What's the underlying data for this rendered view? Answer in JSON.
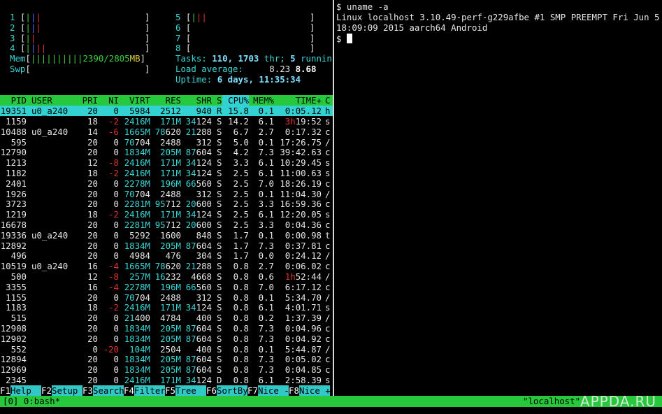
{
  "cpus": [
    {
      "label": "1",
      "bars": [
        "|",
        "|",
        "|"
      ],
      "colors": [
        "gr",
        "bl",
        "rd"
      ]
    },
    {
      "label": "2",
      "bars": [
        "|",
        "|",
        "|"
      ],
      "colors": [
        "gr",
        "bl",
        "rd"
      ]
    },
    {
      "label": "3",
      "bars": [
        "|",
        "|"
      ],
      "colors": [
        "gr",
        "rd"
      ]
    },
    {
      "label": "4",
      "bars": [
        "|",
        "|",
        "|",
        "|"
      ],
      "colors": [
        "gr",
        "bl",
        "rd",
        "rd"
      ]
    },
    {
      "label": "5",
      "bars": [
        "|",
        "|",
        "|"
      ],
      "colors": [
        "gr",
        "rd",
        "rd"
      ]
    },
    {
      "label": "6",
      "bars": [],
      "colors": []
    },
    {
      "label": "7",
      "bars": [],
      "colors": []
    },
    {
      "label": "8",
      "bars": [],
      "colors": []
    }
  ],
  "mem": {
    "label": "Mem",
    "bars": "||||||||||",
    "used": "2390/2805",
    "unit": "MB"
  },
  "swp": {
    "label": "Swp"
  },
  "tasks": {
    "label": "Tasks:",
    "count": "110,",
    "threads": "1703",
    "thr": "thr;",
    "running": "5",
    "running_label": "runnin"
  },
  "load": {
    "label": "Load average:",
    "v1": "8.23",
    "v2": "8.68"
  },
  "uptime": {
    "label": "Uptime:",
    "value": "6 days, 11:35:34"
  },
  "columns": [
    "PID",
    "USER",
    "PRI",
    "NI",
    "VIRT",
    "RES",
    "SHR",
    "S",
    "CPU%",
    "MEM%",
    "TIME+",
    "C"
  ],
  "selected": {
    "pid": "19351",
    "user": "u0_a240",
    "pri": "20",
    "ni": "0",
    "virt": "5984",
    "res": "2512",
    "shr": "940",
    "s": "R",
    "cpu": "15.8",
    "mem": "0.1",
    "time": "0:05.12",
    "c": "h"
  },
  "rows": [
    {
      "pid": "1159",
      "user": "",
      "pri": "18",
      "ni": "-2",
      "virt": "2416M",
      "res": "171M",
      "shr": "34124",
      "s": "S",
      "cpu": "14.2",
      "mem": "6.1",
      "time": "3h19:52",
      "c": "s"
    },
    {
      "pid": "10488",
      "user": "u0_a240",
      "pri": "14",
      "ni": "-6",
      "virt": "1665M",
      "res": "78620",
      "shr": "21288",
      "s": "S",
      "cpu": "6.7",
      "mem": "2.7",
      "time": "0:17.32",
      "c": "c"
    },
    {
      "pid": "595",
      "user": "",
      "pri": "20",
      "ni": "0",
      "virt": "70704",
      "res": "2488",
      "shr": "312",
      "s": "S",
      "cpu": "5.0",
      "mem": "0.1",
      "time": "17:26.75",
      "c": "/"
    },
    {
      "pid": "12790",
      "user": "",
      "pri": "20",
      "ni": "0",
      "virt": "1834M",
      "res": "205M",
      "shr": "87604",
      "s": "S",
      "cpu": "4.2",
      "mem": "7.3",
      "time": "39:42.63",
      "c": "c"
    },
    {
      "pid": "1213",
      "user": "",
      "pri": "12",
      "ni": "-8",
      "virt": "2416M",
      "res": "171M",
      "shr": "34124",
      "s": "S",
      "cpu": "3.3",
      "mem": "6.1",
      "time": "10:29.45",
      "c": "s"
    },
    {
      "pid": "1182",
      "user": "",
      "pri": "18",
      "ni": "-2",
      "virt": "2416M",
      "res": "171M",
      "shr": "34124",
      "s": "S",
      "cpu": "2.5",
      "mem": "6.1",
      "time": "11:00.63",
      "c": "s"
    },
    {
      "pid": "2401",
      "user": "",
      "pri": "20",
      "ni": "0",
      "virt": "2278M",
      "res": "196M",
      "shr": "66560",
      "s": "S",
      "cpu": "2.5",
      "mem": "7.0",
      "time": "18:26.19",
      "c": "c"
    },
    {
      "pid": "1926",
      "user": "",
      "pri": "20",
      "ni": "0",
      "virt": "70704",
      "res": "2488",
      "shr": "312",
      "s": "S",
      "cpu": "2.5",
      "mem": "0.1",
      "time": "11:04.30",
      "c": "/"
    },
    {
      "pid": "3723",
      "user": "",
      "pri": "20",
      "ni": "0",
      "virt": "2281M",
      "res": "95712",
      "shr": "20600",
      "s": "S",
      "cpu": "2.5",
      "mem": "3.3",
      "time": "16:59.36",
      "c": "c"
    },
    {
      "pid": "1219",
      "user": "",
      "pri": "18",
      "ni": "-2",
      "virt": "2416M",
      "res": "171M",
      "shr": "34124",
      "s": "S",
      "cpu": "2.5",
      "mem": "6.1",
      "time": "12:20.05",
      "c": "s"
    },
    {
      "pid": "16678",
      "user": "",
      "pri": "20",
      "ni": "0",
      "virt": "2281M",
      "res": "95712",
      "shr": "20600",
      "s": "S",
      "cpu": "2.5",
      "mem": "3.3",
      "time": "0:04.36",
      "c": "c"
    },
    {
      "pid": "19336",
      "user": "u0_a240",
      "pri": "20",
      "ni": "0",
      "virt": "5292",
      "res": "1600",
      "shr": "848",
      "s": "S",
      "cpu": "1.7",
      "mem": "0.1",
      "time": "0:00.98",
      "c": "t"
    },
    {
      "pid": "12892",
      "user": "",
      "pri": "20",
      "ni": "0",
      "virt": "1834M",
      "res": "205M",
      "shr": "87604",
      "s": "S",
      "cpu": "1.7",
      "mem": "7.3",
      "time": "0:37.81",
      "c": "c"
    },
    {
      "pid": "496",
      "user": "",
      "pri": "20",
      "ni": "0",
      "virt": "4984",
      "res": "476",
      "shr": "304",
      "s": "S",
      "cpu": "1.7",
      "mem": "0.0",
      "time": "0:24.12",
      "c": "/"
    },
    {
      "pid": "10519",
      "user": "u0_a240",
      "pri": "16",
      "ni": "-4",
      "virt": "1665M",
      "res": "78620",
      "shr": "21288",
      "s": "S",
      "cpu": "0.8",
      "mem": "2.7",
      "time": "0:06.02",
      "c": "c"
    },
    {
      "pid": "500",
      "user": "",
      "pri": "12",
      "ni": "-8",
      "virt": "257M",
      "res": "16232",
      "shr": "4668",
      "s": "S",
      "cpu": "0.8",
      "mem": "0.6",
      "time": "1h52:44",
      "c": "/"
    },
    {
      "pid": "3355",
      "user": "",
      "pri": "16",
      "ni": "-4",
      "virt": "2278M",
      "res": "196M",
      "shr": "66560",
      "s": "S",
      "cpu": "0.8",
      "mem": "7.0",
      "time": "6:17.12",
      "c": "c"
    },
    {
      "pid": "1155",
      "user": "",
      "pri": "20",
      "ni": "0",
      "virt": "70704",
      "res": "2488",
      "shr": "312",
      "s": "S",
      "cpu": "0.8",
      "mem": "0.1",
      "time": "5:34.70",
      "c": "/"
    },
    {
      "pid": "1183",
      "user": "",
      "pri": "18",
      "ni": "-2",
      "virt": "2416M",
      "res": "171M",
      "shr": "34124",
      "s": "S",
      "cpu": "0.8",
      "mem": "6.1",
      "time": "4:01.71",
      "c": "s"
    },
    {
      "pid": "515",
      "user": "",
      "pri": "20",
      "ni": "0",
      "virt": "21400",
      "res": "4784",
      "shr": "400",
      "s": "S",
      "cpu": "0.8",
      "mem": "0.2",
      "time": "1:37.39",
      "c": "/"
    },
    {
      "pid": "12908",
      "user": "",
      "pri": "20",
      "ni": "0",
      "virt": "1834M",
      "res": "205M",
      "shr": "87604",
      "s": "S",
      "cpu": "0.8",
      "mem": "7.3",
      "time": "0:04.96",
      "c": "c"
    },
    {
      "pid": "12902",
      "user": "",
      "pri": "20",
      "ni": "0",
      "virt": "1834M",
      "res": "205M",
      "shr": "87604",
      "s": "S",
      "cpu": "0.8",
      "mem": "7.3",
      "time": "0:04.92",
      "c": "c"
    },
    {
      "pid": "552",
      "user": "",
      "pri": "0",
      "ni": "-20",
      "virt": "104M",
      "res": "2504",
      "shr": "400",
      "s": "S",
      "cpu": "0.8",
      "mem": "0.1",
      "time": "5:44.87",
      "c": "/"
    },
    {
      "pid": "12894",
      "user": "",
      "pri": "20",
      "ni": "0",
      "virt": "1834M",
      "res": "205M",
      "shr": "87604",
      "s": "S",
      "cpu": "0.8",
      "mem": "7.3",
      "time": "0:05.02",
      "c": "c"
    },
    {
      "pid": "12969",
      "user": "",
      "pri": "20",
      "ni": "0",
      "virt": "1834M",
      "res": "205M",
      "shr": "87604",
      "s": "S",
      "cpu": "0.8",
      "mem": "7.3",
      "time": "0:04.85",
      "c": "c"
    },
    {
      "pid": "2345",
      "user": "",
      "pri": "20",
      "ni": "0",
      "virt": "2416M",
      "res": "171M",
      "shr": "34124",
      "s": "D",
      "cpu": "0.8",
      "mem": "6.1",
      "time": "2:58.39",
      "c": "s"
    }
  ],
  "fkeys": [
    {
      "key": "F1",
      "label": "Help  "
    },
    {
      "key": "F2",
      "label": "Setup "
    },
    {
      "key": "F3",
      "label": "Search"
    },
    {
      "key": "F4",
      "label": "Filter"
    },
    {
      "key": "F5",
      "label": "Tree  "
    },
    {
      "key": "F6",
      "label": "SortBy"
    },
    {
      "key": "F7",
      "label": "Nice -"
    },
    {
      "key": "F8",
      "label": "Nice +"
    }
  ],
  "terminal": {
    "line1": "$ uname -a",
    "line2": "Linux localhost 3.10.49-perf-g229afbe #1 SMP PREEMPT Fri Jun 5",
    "line3": "18:09:09 2015 aarch64 Android",
    "prompt": "$ "
  },
  "tmux": {
    "window": "[0] 0:bash*",
    "host": "\"localhost\" "
  },
  "watermark": "APPDA.RU",
  "colors": {
    "header_green": "#28c83c",
    "selected_cyan": "#32d2d2",
    "cyan_text": "#3ad6d6",
    "red_text": "#e03030"
  }
}
